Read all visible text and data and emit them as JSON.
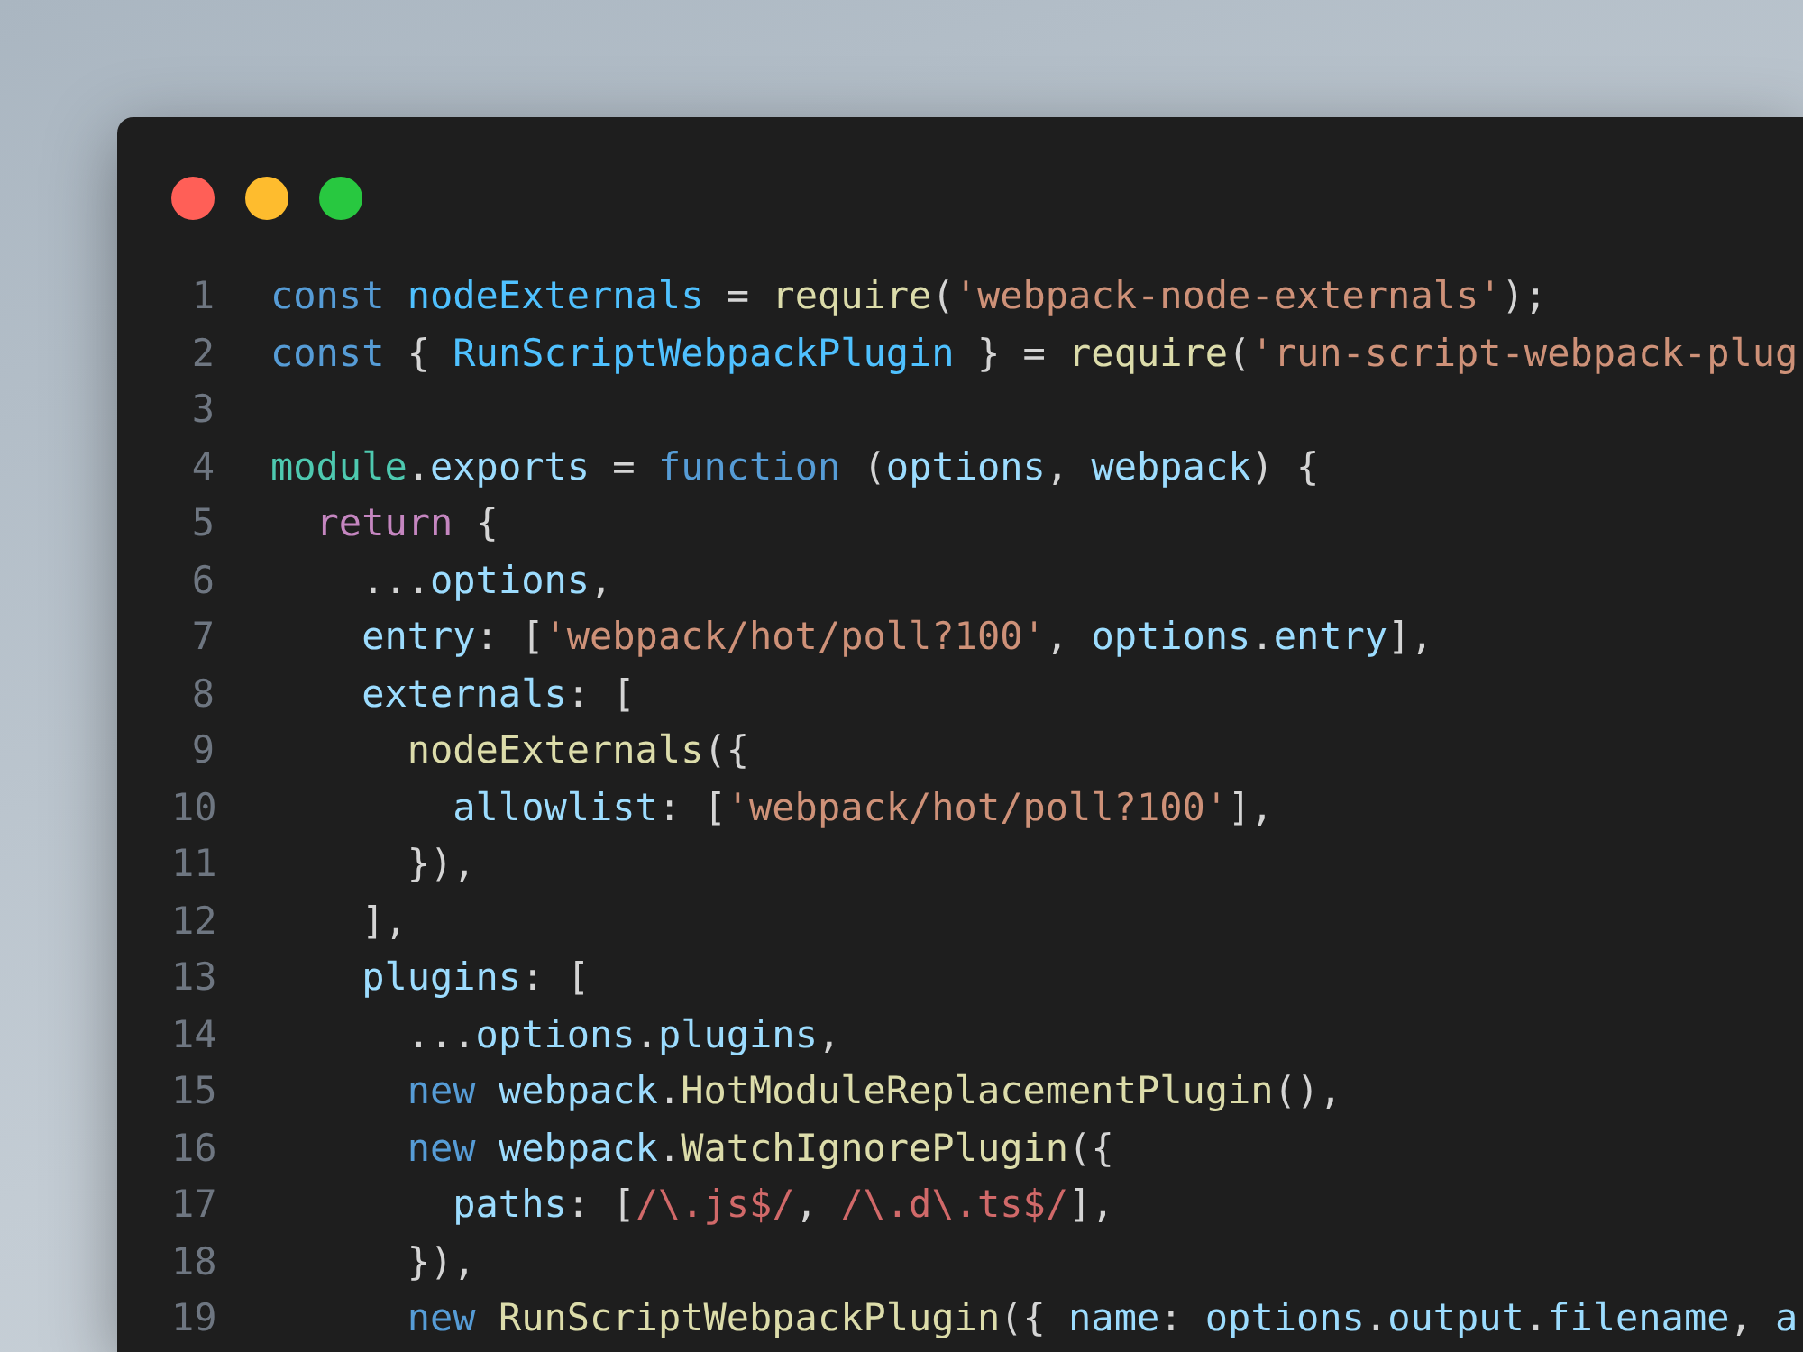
{
  "window": {
    "controls": [
      {
        "kind": "close"
      },
      {
        "kind": "minimize"
      },
      {
        "kind": "zoom"
      }
    ]
  },
  "lines": [
    {
      "number": "1",
      "tokens": [
        {
          "kind": "keyword",
          "text": "const "
        },
        {
          "kind": "constant",
          "text": "nodeExternals"
        },
        {
          "kind": "plain",
          "text": " = "
        },
        {
          "kind": "function",
          "text": "require"
        },
        {
          "kind": "plain",
          "text": "("
        },
        {
          "kind": "string",
          "text": "'webpack-node-externals'"
        },
        {
          "kind": "plain",
          "text": ");"
        }
      ]
    },
    {
      "number": "2",
      "tokens": [
        {
          "kind": "keyword",
          "text": "const"
        },
        {
          "kind": "plain",
          "text": " { "
        },
        {
          "kind": "constant",
          "text": "RunScriptWebpackPlugin"
        },
        {
          "kind": "plain",
          "text": " } = "
        },
        {
          "kind": "function",
          "text": "require"
        },
        {
          "kind": "plain",
          "text": "("
        },
        {
          "kind": "string",
          "text": "'run-script-webpack-plug"
        }
      ]
    },
    {
      "number": "3"
    },
    {
      "number": "4",
      "tokens": [
        {
          "kind": "class",
          "text": "module"
        },
        {
          "kind": "plain",
          "text": "."
        },
        {
          "kind": "variable",
          "text": "exports"
        },
        {
          "kind": "plain",
          "text": " = "
        },
        {
          "kind": "keyword",
          "text": "function"
        },
        {
          "kind": "plain",
          "text": " ("
        },
        {
          "kind": "variable",
          "text": "options"
        },
        {
          "kind": "plain",
          "text": ", "
        },
        {
          "kind": "variable",
          "text": "webpack"
        },
        {
          "kind": "plain",
          "text": ") {"
        }
      ]
    },
    {
      "number": "5",
      "tokens": [
        {
          "kind": "control",
          "text": "  return"
        },
        {
          "kind": "plain",
          "text": " {"
        }
      ]
    },
    {
      "number": "6",
      "tokens": [
        {
          "kind": "plain",
          "text": "    ..."
        },
        {
          "kind": "variable",
          "text": "options"
        },
        {
          "kind": "plain",
          "text": ","
        }
      ]
    },
    {
      "number": "7",
      "tokens": [
        {
          "kind": "variable",
          "text": "    entry"
        },
        {
          "kind": "plain",
          "text": ": ["
        },
        {
          "kind": "string",
          "text": "'webpack/hot/poll?100'"
        },
        {
          "kind": "plain",
          "text": ", "
        },
        {
          "kind": "variable",
          "text": "options"
        },
        {
          "kind": "plain",
          "text": "."
        },
        {
          "kind": "variable",
          "text": "entry"
        },
        {
          "kind": "plain",
          "text": "],"
        }
      ]
    },
    {
      "number": "8",
      "tokens": [
        {
          "kind": "variable",
          "text": "    externals"
        },
        {
          "kind": "plain",
          "text": ": ["
        }
      ]
    },
    {
      "number": "9",
      "tokens": [
        {
          "kind": "function",
          "text": "      nodeExternals"
        },
        {
          "kind": "plain",
          "text": "({"
        }
      ]
    },
    {
      "number": "10",
      "tokens": [
        {
          "kind": "variable",
          "text": "        allowlist"
        },
        {
          "kind": "plain",
          "text": ": ["
        },
        {
          "kind": "string",
          "text": "'webpack/hot/poll?100'"
        },
        {
          "kind": "plain",
          "text": "],"
        }
      ]
    },
    {
      "number": "11",
      "tokens": [
        {
          "kind": "plain",
          "text": "      }),"
        }
      ]
    },
    {
      "number": "12",
      "tokens": [
        {
          "kind": "plain",
          "text": "    ],"
        }
      ]
    },
    {
      "number": "13",
      "tokens": [
        {
          "kind": "variable",
          "text": "    plugins"
        },
        {
          "kind": "plain",
          "text": ": ["
        }
      ]
    },
    {
      "number": "14",
      "tokens": [
        {
          "kind": "plain",
          "text": "      ..."
        },
        {
          "kind": "variable",
          "text": "options"
        },
        {
          "kind": "plain",
          "text": "."
        },
        {
          "kind": "variable",
          "text": "plugins"
        },
        {
          "kind": "plain",
          "text": ","
        }
      ]
    },
    {
      "number": "15",
      "tokens": [
        {
          "kind": "keyword",
          "text": "      new "
        },
        {
          "kind": "variable",
          "text": "webpack"
        },
        {
          "kind": "plain",
          "text": "."
        },
        {
          "kind": "function",
          "text": "HotModuleReplacementPlugin"
        },
        {
          "kind": "plain",
          "text": "(),"
        }
      ]
    },
    {
      "number": "16",
      "tokens": [
        {
          "kind": "keyword",
          "text": "      new "
        },
        {
          "kind": "variable",
          "text": "webpack"
        },
        {
          "kind": "plain",
          "text": "."
        },
        {
          "kind": "function",
          "text": "WatchIgnorePlugin"
        },
        {
          "kind": "plain",
          "text": "({"
        }
      ]
    },
    {
      "number": "17",
      "tokens": [
        {
          "kind": "variable",
          "text": "        paths"
        },
        {
          "kind": "plain",
          "text": ": ["
        },
        {
          "kind": "regex",
          "text": "/\\.js$/"
        },
        {
          "kind": "plain",
          "text": ", "
        },
        {
          "kind": "regex",
          "text": "/\\.d\\.ts$/"
        },
        {
          "kind": "plain",
          "text": "],"
        }
      ]
    },
    {
      "number": "18",
      "tokens": [
        {
          "kind": "plain",
          "text": "      }),"
        }
      ]
    },
    {
      "number": "19",
      "tokens": [
        {
          "kind": "keyword",
          "text": "      new "
        },
        {
          "kind": "function",
          "text": "RunScriptWebpackPlugin"
        },
        {
          "kind": "plain",
          "text": "({ "
        },
        {
          "kind": "variable",
          "text": "name"
        },
        {
          "kind": "plain",
          "text": ": "
        },
        {
          "kind": "variable",
          "text": "options"
        },
        {
          "kind": "plain",
          "text": "."
        },
        {
          "kind": "variable",
          "text": "output"
        },
        {
          "kind": "plain",
          "text": "."
        },
        {
          "kind": "variable",
          "text": "filename"
        },
        {
          "kind": "plain",
          "text": ", "
        },
        {
          "kind": "variable",
          "text": "a"
        }
      ]
    }
  ]
}
